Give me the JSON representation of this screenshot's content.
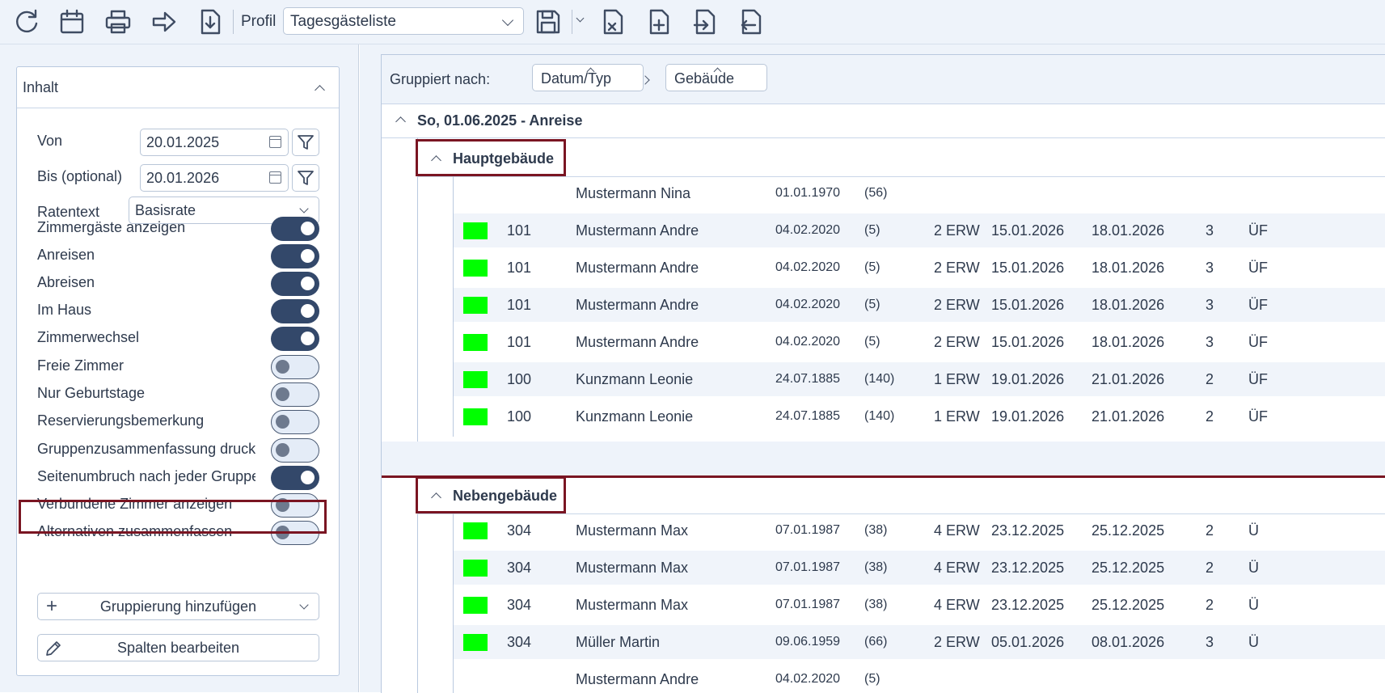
{
  "toolbar": {
    "buttons": [
      {
        "name": "refresh-icon"
      },
      {
        "name": "calendar-icon"
      },
      {
        "name": "print-icon"
      },
      {
        "name": "forward-arrow-icon"
      },
      {
        "name": "download-icon"
      }
    ],
    "profil_label": "Profil",
    "profil_value": "Tagesgästeliste",
    "right_buttons": [
      {
        "name": "save-icon"
      },
      {
        "name": "file-delete-icon"
      },
      {
        "name": "file-add-icon"
      },
      {
        "name": "file-import-icon"
      },
      {
        "name": "file-export-icon"
      }
    ]
  },
  "panel": {
    "title": "Inhalt",
    "von_label": "Von",
    "von_value": "20.01.2025",
    "bis_label": "Bis (optional)",
    "bis_value": "20.01.2026",
    "ratentext_label": "Ratentext",
    "ratentext_value": "Basisrate",
    "toggles": [
      {
        "label": "Zimmergäste anzeigen",
        "on": true
      },
      {
        "label": "Anreisen",
        "on": true
      },
      {
        "label": "Abreisen",
        "on": true
      },
      {
        "label": "Im Haus",
        "on": true
      },
      {
        "label": "Zimmerwechsel",
        "on": true
      },
      {
        "label": "Freie Zimmer",
        "on": false
      },
      {
        "label": "Nur Geburtstage",
        "on": false
      },
      {
        "label": "Reservierungsbemerkung",
        "on": false
      },
      {
        "label": "Gruppenzusammenfassung drucken",
        "on": false
      },
      {
        "label": "Seitenumbruch nach jeder Gruppe",
        "on": true
      },
      {
        "label": "Verbundene Zimmer anzeigen",
        "on": false
      },
      {
        "label": "Alternativen zusammenfassen",
        "on": false
      }
    ],
    "add_grouping_label": "Gruppierung hinzufügen",
    "edit_columns_label": "Spalten bearbeiten"
  },
  "grid": {
    "grouped_by_label": "Gruppiert nach:",
    "chips": [
      "Datum/Typ",
      "Gebäude"
    ],
    "date_group": "So, 01.06.2025 - Anreise",
    "groups": [
      {
        "title": "Hauptgebäude",
        "rows": [
          {
            "swatch": false,
            "room": "",
            "name": "Mustermann Nina",
            "birth": "01.01.1970",
            "age": "(56)",
            "pers": "",
            "arrival": "",
            "departure": "",
            "nights": "",
            "board": ""
          },
          {
            "swatch": true,
            "room": "101",
            "name": "Mustermann Andre",
            "birth": "04.02.2020",
            "age": "(5)",
            "pers": "2 ERW",
            "arrival": "15.01.2026",
            "departure": "18.01.2026",
            "nights": "3",
            "board": "ÜF"
          },
          {
            "swatch": true,
            "room": "101",
            "name": "Mustermann Andre",
            "birth": "04.02.2020",
            "age": "(5)",
            "pers": "2 ERW",
            "arrival": "15.01.2026",
            "departure": "18.01.2026",
            "nights": "3",
            "board": "ÜF"
          },
          {
            "swatch": true,
            "room": "101",
            "name": "Mustermann Andre",
            "birth": "04.02.2020",
            "age": "(5)",
            "pers": "2 ERW",
            "arrival": "15.01.2026",
            "departure": "18.01.2026",
            "nights": "3",
            "board": "ÜF"
          },
          {
            "swatch": true,
            "room": "101",
            "name": "Mustermann Andre",
            "birth": "04.02.2020",
            "age": "(5)",
            "pers": "2 ERW",
            "arrival": "15.01.2026",
            "departure": "18.01.2026",
            "nights": "3",
            "board": "ÜF"
          },
          {
            "swatch": true,
            "room": "100",
            "name": "Kunzmann Leonie",
            "birth": "24.07.1885",
            "age": "(140)",
            "pers": "1 ERW",
            "arrival": "19.01.2026",
            "departure": "21.01.2026",
            "nights": "2",
            "board": "ÜF"
          },
          {
            "swatch": true,
            "room": "100",
            "name": "Kunzmann Leonie",
            "birth": "24.07.1885",
            "age": "(140)",
            "pers": "1 ERW",
            "arrival": "19.01.2026",
            "departure": "21.01.2026",
            "nights": "2",
            "board": "ÜF"
          }
        ]
      },
      {
        "title": "Nebengebäude",
        "rows": [
          {
            "swatch": true,
            "room": "304",
            "name": "Mustermann Max",
            "birth": "07.01.1987",
            "age": "(38)",
            "pers": "4 ERW",
            "arrival": "23.12.2025",
            "departure": "25.12.2025",
            "nights": "2",
            "board": "Ü"
          },
          {
            "swatch": true,
            "room": "304",
            "name": "Mustermann Max",
            "birth": "07.01.1987",
            "age": "(38)",
            "pers": "4 ERW",
            "arrival": "23.12.2025",
            "departure": "25.12.2025",
            "nights": "2",
            "board": "Ü"
          },
          {
            "swatch": true,
            "room": "304",
            "name": "Mustermann Max",
            "birth": "07.01.1987",
            "age": "(38)",
            "pers": "4 ERW",
            "arrival": "23.12.2025",
            "departure": "25.12.2025",
            "nights": "2",
            "board": "Ü"
          },
          {
            "swatch": true,
            "room": "304",
            "name": "Müller Martin",
            "birth": "09.06.1959",
            "age": "(66)",
            "pers": "2 ERW",
            "arrival": "05.01.2026",
            "departure": "08.01.2026",
            "nights": "3",
            "board": "Ü"
          },
          {
            "swatch": false,
            "room": "",
            "name": "Mustermann Andre",
            "birth": "04.02.2020",
            "age": "(5)",
            "pers": "",
            "arrival": "",
            "departure": "",
            "nights": "",
            "board": ""
          }
        ]
      }
    ]
  },
  "colors": {
    "accent": "#33486a",
    "highlight": "#7a1522",
    "swatch": "#00ff00",
    "panel_bg": "#eef3fa"
  }
}
